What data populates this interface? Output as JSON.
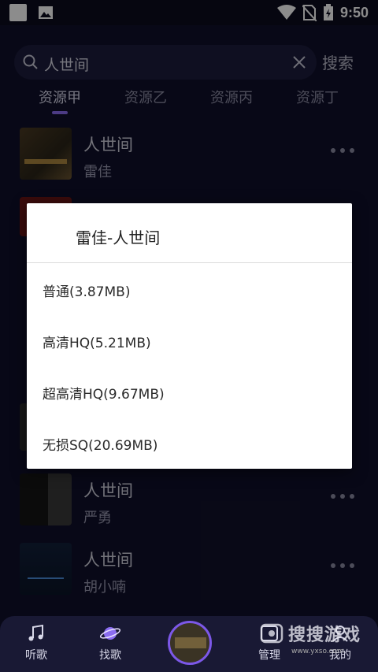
{
  "status_bar": {
    "time": "9:50",
    "icons": [
      "notification-square-icon",
      "image-icon",
      "wifi-icon",
      "no-sim-icon",
      "battery-charging-icon"
    ]
  },
  "search": {
    "query": "人世间",
    "button_label": "搜索"
  },
  "tabs": [
    {
      "label": "资源甲",
      "active": true
    },
    {
      "label": "资源乙",
      "active": false
    },
    {
      "label": "资源丙",
      "active": false
    },
    {
      "label": "资源丁",
      "active": false
    }
  ],
  "songs": [
    {
      "title": "人世间",
      "artist": "雷佳"
    },
    {
      "title": "人世间",
      "artist": "严勇"
    },
    {
      "title": "人世间",
      "artist": "胡小喃"
    }
  ],
  "dialog": {
    "title": "雷佳-人世间",
    "options": [
      "普通(3.87MB)",
      "高清HQ(5.21MB)",
      "超高清HQ(9.67MB)",
      "无损SQ(20.69MB)"
    ]
  },
  "bottom_nav": {
    "items": [
      {
        "label": "听歌",
        "icon": "music-note-icon"
      },
      {
        "label": "找歌",
        "icon": "planet-icon"
      },
      {
        "label": "管理",
        "icon": "manage-icon"
      },
      {
        "label": "我的",
        "icon": "profile-icon"
      }
    ]
  },
  "watermark": {
    "text": "搜搜游戏",
    "url": "www.yxso.com"
  },
  "colors": {
    "background": "#10102a",
    "accent": "#8a6cf0",
    "dialog_bg": "#ffffff"
  }
}
